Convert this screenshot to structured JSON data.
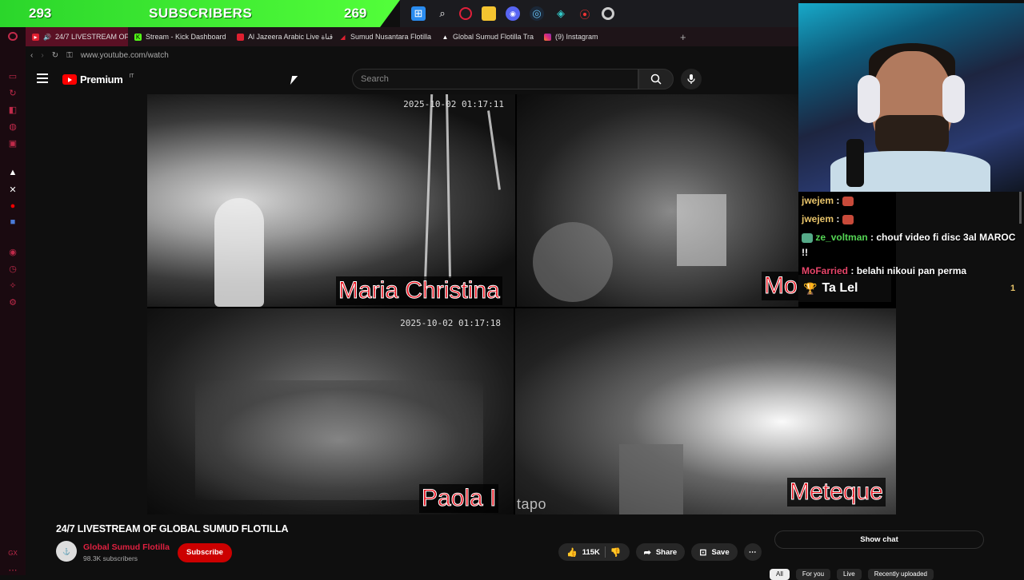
{
  "overlay": {
    "subscribers_left": "293",
    "subscribers_label": "SUBSCRIBERS",
    "subscribers_right": "269"
  },
  "taskbar": {
    "icons": [
      "windows-start-icon",
      "search-icon",
      "opera-icon",
      "file-explorer-icon",
      "discord-icon",
      "steam-icon",
      "app-icon",
      "maps-pin-icon",
      "chrome-icon"
    ]
  },
  "browser": {
    "tabs": [
      {
        "label": "24/7 LIVESTREAM OF",
        "icon": "youtube-icon",
        "active": true
      },
      {
        "label": "Stream - Kick Dashboard",
        "icon": "kick-icon"
      },
      {
        "label": "Al Jazeera Arabic Live قناة",
        "icon": "youtube-icon"
      },
      {
        "label": "Sumud Nusantara Flotilla",
        "icon": "flag-icon"
      },
      {
        "label": "Global Sumud Flotilla Tra",
        "icon": "ship-icon"
      },
      {
        "label": "(9) Instagram",
        "icon": "instagram-icon"
      }
    ],
    "add_tab": "+",
    "url": "www.youtube.com/watch"
  },
  "youtube": {
    "logo_text": "Premium",
    "logo_region": "IT",
    "search_placeholder": "Search"
  },
  "video": {
    "cam1_timestamp": "2025-10-02 01:17:11",
    "cam1_label": "Maria Christina",
    "cam2_label": "Mo",
    "cam3_timestamp": "2025-10-02 01:17:18",
    "cam3_label": "Paola I",
    "cam4_label": "Meteque",
    "watermark": "tapo"
  },
  "chat_overlay": {
    "messages": [
      {
        "user": "jwejem",
        "text": ""
      },
      {
        "user": "jwejem",
        "text": ""
      },
      {
        "user": "ze_voltman",
        "text": "chouf video fi disc 3al MAROC !!"
      },
      {
        "user": "MoFarried",
        "text": "belahi nikoui pan perma"
      }
    ],
    "pinned": "Ta Lel",
    "pinned_count": "1"
  },
  "watch": {
    "title": "24/7 LIVESTREAM OF GLOBAL SUMUD FLOTILLA",
    "channel": "Global Sumud Flotilla",
    "subscribers": "98.3K subscribers",
    "subscribe_label": "Subscribe",
    "likes": "115K",
    "share_label": "Share",
    "save_label": "Save",
    "show_chat_label": "Show chat",
    "chips": [
      "All",
      "For you",
      "Live",
      "Recently uploaded"
    ]
  }
}
